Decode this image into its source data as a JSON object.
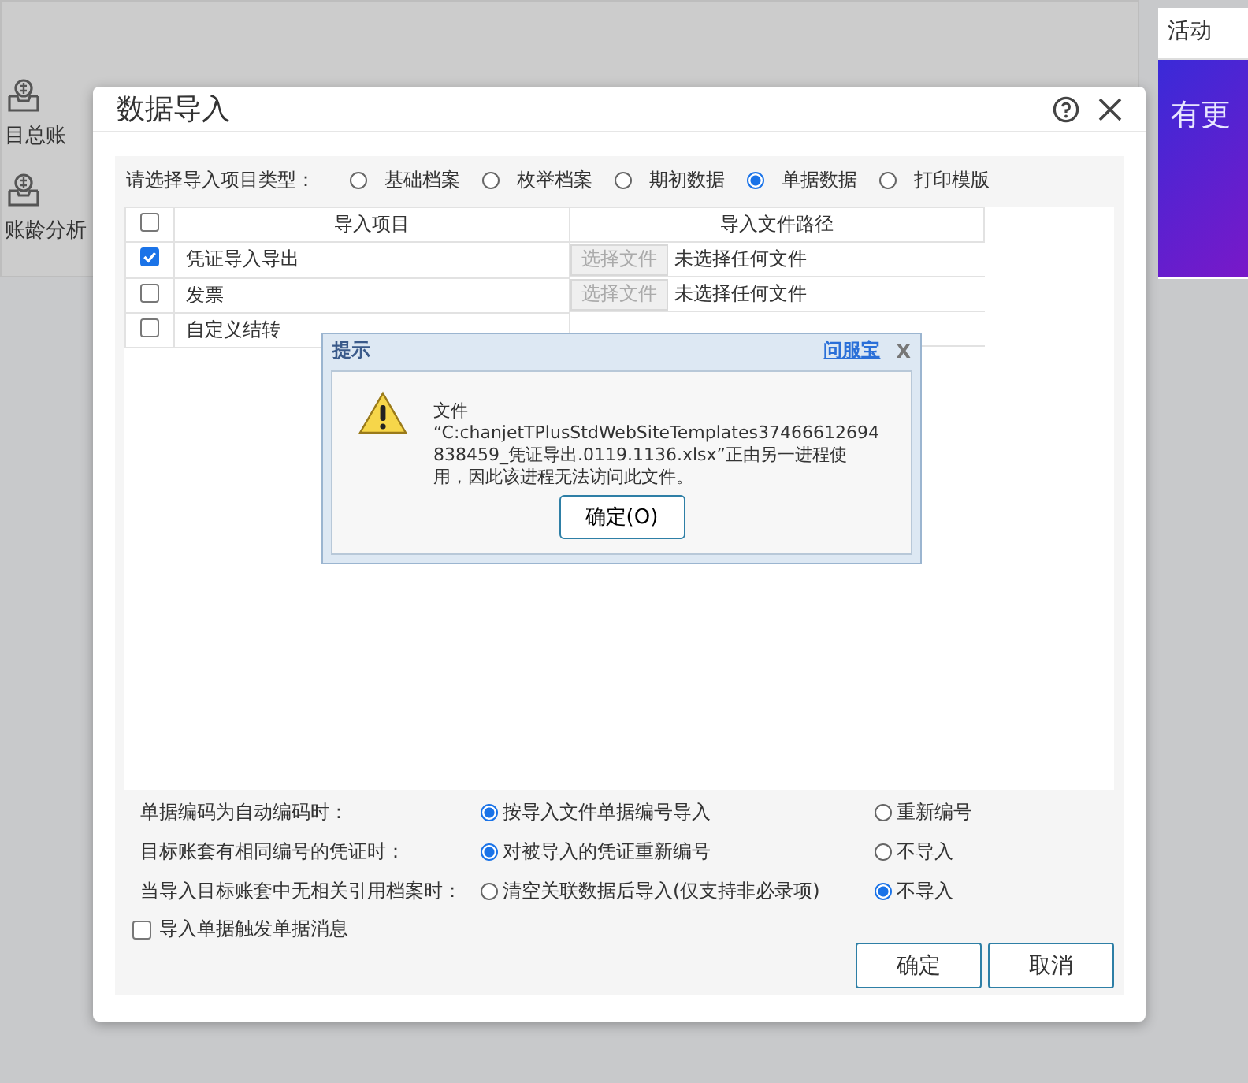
{
  "background": {
    "shortcuts": [
      {
        "label": "目总账"
      },
      {
        "label": "账龄分析"
      }
    ],
    "side_panel": {
      "title": "活动",
      "banner_text": "有更"
    }
  },
  "dialog": {
    "title": "数据导入",
    "type_prompt": "请选择导入项目类型：",
    "types": [
      {
        "label": "基础档案",
        "selected": false
      },
      {
        "label": "枚举档案",
        "selected": false
      },
      {
        "label": "期初数据",
        "selected": false
      },
      {
        "label": "单据数据",
        "selected": true
      },
      {
        "label": "打印模版",
        "selected": false
      }
    ],
    "table": {
      "header_checked": false,
      "columns": [
        "导入项目",
        "导入文件路径"
      ],
      "rows": [
        {
          "checked": true,
          "name": "凭证导入导出",
          "button": "选择文件",
          "path": "未选择任何文件"
        },
        {
          "checked": false,
          "name": "发票",
          "button": "选择文件",
          "path": "未选择任何文件"
        },
        {
          "checked": false,
          "name": "自定义结转"
        }
      ]
    },
    "options": [
      {
        "label": "单据编码为自动编码时：",
        "choices": [
          {
            "label": "按导入文件单据编号导入",
            "selected": true
          },
          {
            "label": "重新编号",
            "selected": false
          }
        ]
      },
      {
        "label": "目标账套有相同编号的凭证时：",
        "choices": [
          {
            "label": "对被导入的凭证重新编号",
            "selected": true
          },
          {
            "label": "不导入",
            "selected": false
          }
        ]
      },
      {
        "label": "当导入目标账套中无相关引用档案时：",
        "choices": [
          {
            "label": "清空关联数据后导入(仅支持非必录项)",
            "selected": false
          },
          {
            "label": "不导入",
            "selected": true
          }
        ]
      }
    ],
    "notify": {
      "label": "导入单据触发单据消息",
      "checked": false
    },
    "buttons": [
      "确定",
      "取消"
    ]
  },
  "alert": {
    "title": "提示",
    "link": "问服宝",
    "close": "X",
    "message_lines": [
      "文件",
      "“C:chanjetTPlusStdWebSiteTemplates37466612694",
      "838459_凭证导出.0119.1136.xlsx”正由另一进程使",
      "用，因此该进程无法访问此文件。"
    ],
    "button": "确定(O)"
  }
}
